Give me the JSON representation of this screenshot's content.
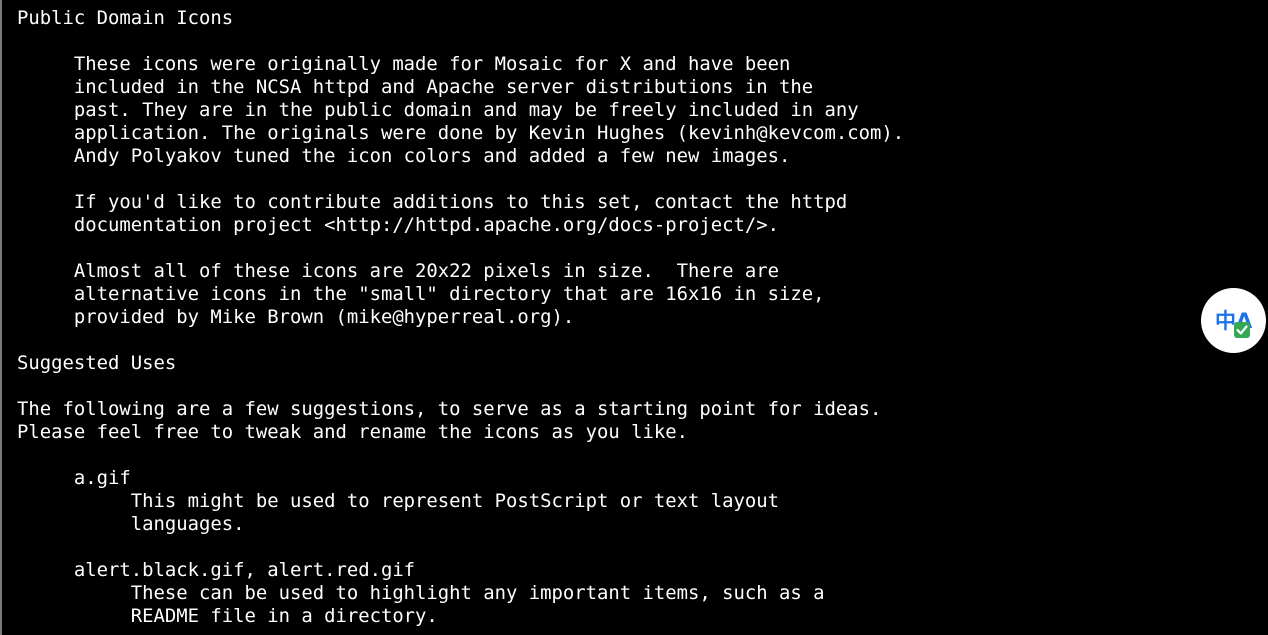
{
  "document": {
    "text": "Public Domain Icons\n\n     These icons were originally made for Mosaic for X and have been\n     included in the NCSA httpd and Apache server distributions in the\n     past. They are in the public domain and may be freely included in any\n     application. The originals were done by Kevin Hughes (kevinh@kevcom.com).\n     Andy Polyakov tuned the icon colors and added a few new images.\n\n     If you'd like to contribute additions to this set, contact the httpd\n     documentation project <http://httpd.apache.org/docs-project/>.\n\n     Almost all of these icons are 20x22 pixels in size.  There are\n     alternative icons in the \"small\" directory that are 16x16 in size,\n     provided by Mike Brown (mike@hyperreal.org).\n\nSuggested Uses\n\nThe following are a few suggestions, to serve as a starting point for ideas.\nPlease feel free to tweak and rename the icons as you like.\n\n     a.gif\n          This might be used to represent PostScript or text layout\n          languages.\n\n     alert.black.gif, alert.red.gif\n          These can be used to highlight any important items, such as a\n          README file in a directory."
  },
  "translate_button": {
    "icon": "translate-icon",
    "glyph": "中A",
    "accent_color": "#1a73e8",
    "check_color": "#34a853"
  },
  "colors": {
    "background": "#000000",
    "text": "#ffffff",
    "left_border": "#7a7a7a"
  }
}
